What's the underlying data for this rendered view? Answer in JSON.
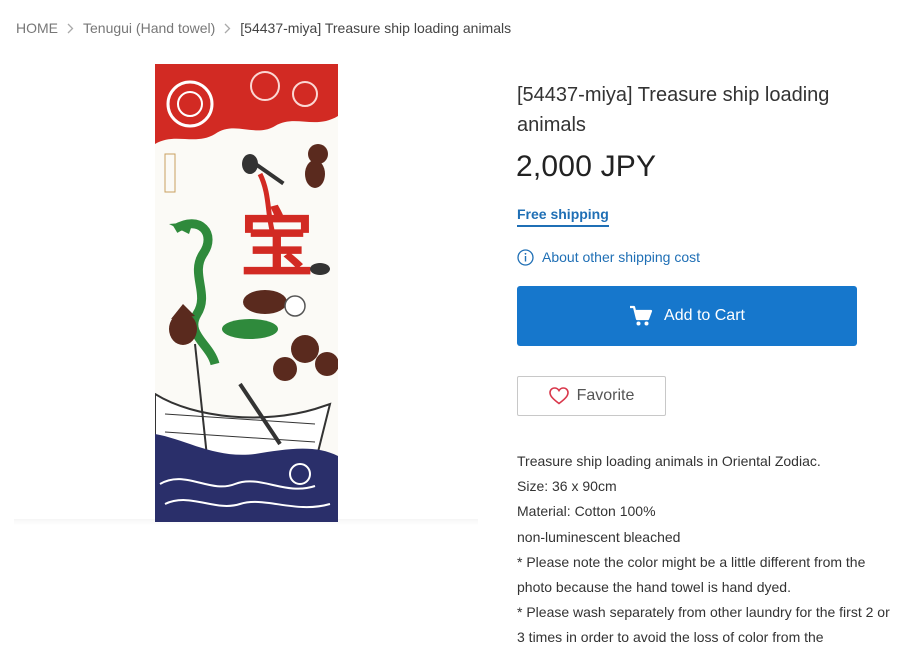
{
  "breadcrumb": {
    "home": "HOME",
    "category": "Tenugui (Hand towel)",
    "current": "[54437-miya] Treasure ship loading animals"
  },
  "product": {
    "title": "[54437-miya] Treasure ship loading animals",
    "price": "2,000 JPY",
    "image_kanji": "宝",
    "colors": {
      "red": "#d22a23",
      "navy": "#2a2f6a",
      "green": "#2f8a3c",
      "brown": "#5a2a1e"
    }
  },
  "shipping": {
    "free_label": "Free shipping",
    "about_label": "About other shipping cost"
  },
  "actions": {
    "add_to_cart": "Add to Cart",
    "favorite": "Favorite",
    "accent_color": "#1677cc"
  },
  "description": [
    "Treasure ship loading animals in Oriental Zodiac.",
    "Size: 36 x 90cm",
    "Material: Cotton 100%",
    "non-luminescent bleached",
    "* Please note the color might be a little different from the photo because the hand towel is hand dyed.",
    "* Please wash separately from other laundry for the first 2 or 3 times in order to avoid the loss of color from the"
  ]
}
